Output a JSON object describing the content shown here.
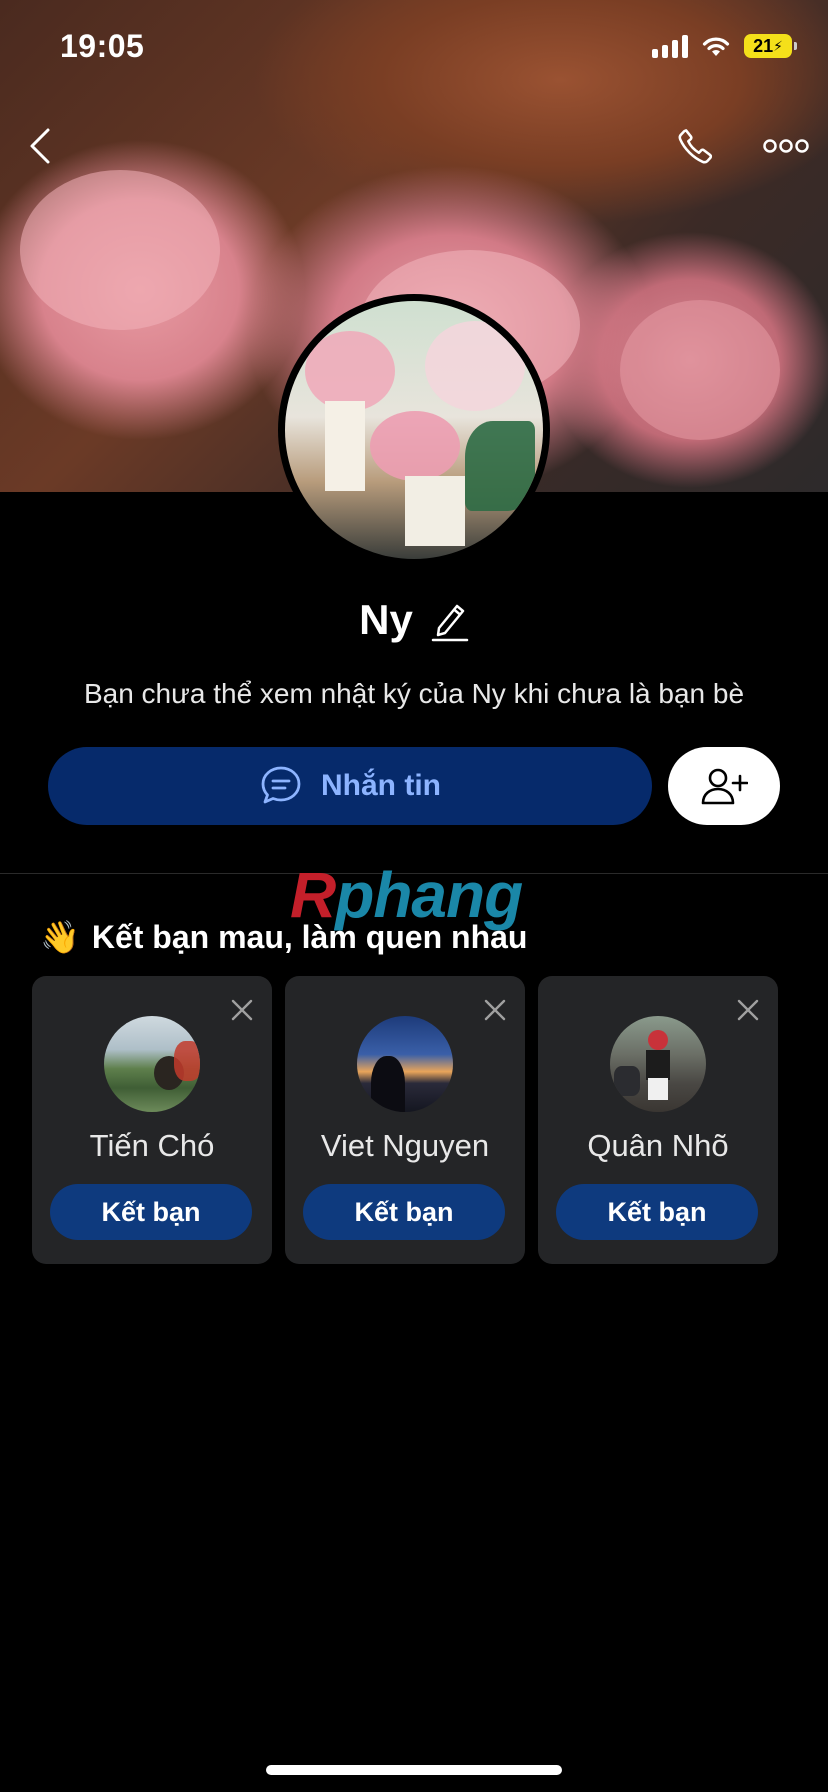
{
  "status_bar": {
    "time": "19:05",
    "battery": "21"
  },
  "profile": {
    "name": "Ny",
    "notice": "Bạn chưa thể xem nhật ký của Ny khi chưa là bạn bè",
    "message_button": "Nhắn tin"
  },
  "watermark": {
    "r": "R",
    "rest": "phang"
  },
  "suggestions": {
    "emoji": "👋",
    "title": "Kết bạn mau, làm quen nhau",
    "items": [
      {
        "name": "Tiến Chó",
        "button": "Kết bạn"
      },
      {
        "name": "Viet Nguyen",
        "button": "Kết bạn"
      },
      {
        "name": "Quân Nhõ",
        "button": "Kết bạn"
      }
    ]
  },
  "colors": {
    "primary_button": "#062a6b",
    "card_bg": "#242527",
    "add_friend_button": "#0e3a7e",
    "battery": "#f4e01a"
  },
  "icons": [
    "back-icon",
    "phone-icon",
    "more-icon",
    "edit-icon",
    "chat-icon",
    "add-friend-icon",
    "close-icon"
  ]
}
